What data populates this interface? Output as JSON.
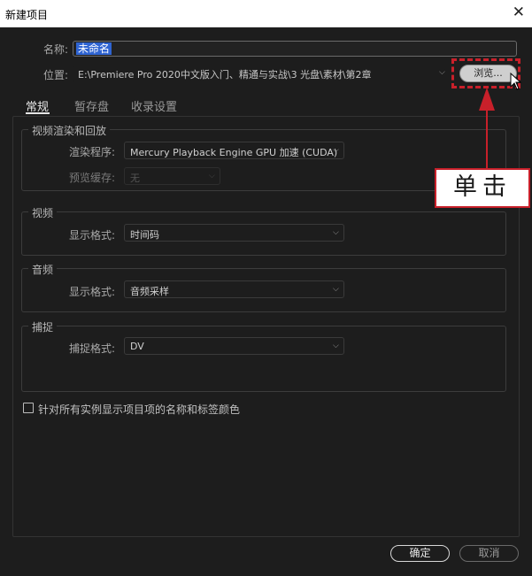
{
  "window": {
    "title": "新建项目",
    "close_glyph": "✕"
  },
  "name": {
    "label": "名称:",
    "value": "未命名"
  },
  "location": {
    "label": "位置:",
    "value": "E:\\Premiere Pro 2020中文版入门、精通与实战\\3 光盘\\素材\\第2章"
  },
  "browse_label": "浏览...",
  "tabs": [
    {
      "label": "常规",
      "active": true
    },
    {
      "label": "暂存盘",
      "active": false
    },
    {
      "label": "收录设置",
      "active": false
    }
  ],
  "groups": {
    "render": {
      "title": "视频渲染和回放",
      "renderer_label": "渲染程序:",
      "renderer_value": "Mercury Playback Engine GPU 加速 (CUDA)",
      "preview_label": "预览缓存:",
      "preview_value": "无"
    },
    "video": {
      "title": "视频",
      "format_label": "显示格式:",
      "format_value": "时间码"
    },
    "audio": {
      "title": "音频",
      "format_label": "显示格式:",
      "format_value": "音频采样"
    },
    "capture": {
      "title": "捕捉",
      "format_label": "捕捉格式:",
      "format_value": "DV"
    }
  },
  "checkbox_label": "针对所有实例显示项目项的名称和标签颜色",
  "annotation": {
    "text": "单击",
    "color": "#c8202a"
  },
  "buttons": {
    "ok": "确定",
    "cancel": "取消"
  },
  "icons": {
    "dropdown": "chevron-down-icon",
    "cursor": "mouse-pointer-icon",
    "close": "close-icon"
  },
  "colors": {
    "background": "#1d1d1d",
    "selection": "#2f64d2",
    "accent_red": "#c8202a"
  }
}
